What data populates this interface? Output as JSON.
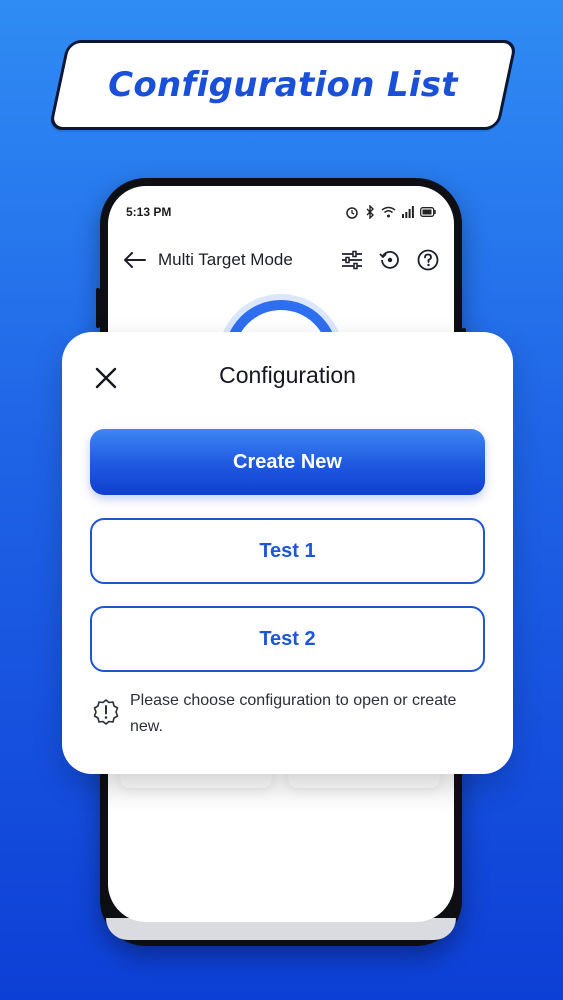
{
  "banner": {
    "title": "Configuration List"
  },
  "status_bar": {
    "time": "5:13 PM"
  },
  "app_bar": {
    "title": "Multi Target Mode",
    "icons": [
      "back-arrow-icon",
      "sliders-icon",
      "history-icon",
      "help-icon"
    ]
  },
  "modal": {
    "title": "Configuration",
    "close_icon": "close-icon",
    "create_label": "Create New",
    "configs": [
      {
        "label": "Test 1"
      },
      {
        "label": "Test 2"
      }
    ],
    "hint": "Please choose configuration to open or create new.",
    "hint_icon": "alert-badge-icon"
  },
  "colors": {
    "background_top": "#2f8cf4",
    "background_bottom": "#0d3fd6",
    "accent": "#1d55d6",
    "banner_text": "#1a4fd8"
  }
}
